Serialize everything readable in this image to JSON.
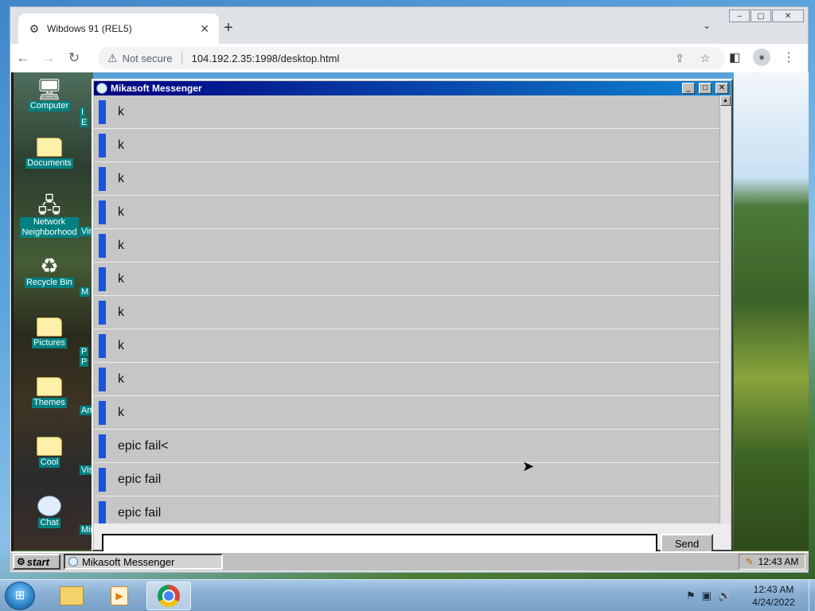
{
  "browser": {
    "tab_title": "Wibdows 91 (REL5)",
    "tab_favicon": "gear-icon",
    "tab_close": "✕",
    "new_tab": "+",
    "tab_search": "⌄",
    "security_label": "Not secure",
    "url": "104.192.2.35:1998/desktop.html",
    "window_controls": {
      "minimize": "–",
      "maximize": "▢",
      "close": "✕"
    }
  },
  "desktop": {
    "icons": [
      {
        "label": "Computer",
        "icon": "computer-icon"
      },
      {
        "label": "Documents",
        "icon": "documents-icon"
      },
      {
        "label": "Network\nNeighborhood",
        "icon": "network-icon"
      },
      {
        "label": "Recycle Bin",
        "icon": "recycle-bin-icon"
      },
      {
        "label": "Pictures",
        "icon": "folder-icon"
      },
      {
        "label": "Themes",
        "icon": "folder-icon"
      },
      {
        "label": "Cool",
        "icon": "folder-icon"
      },
      {
        "label": "Chat",
        "icon": "chat-icon"
      }
    ],
    "peek_labels": [
      "I",
      "E",
      "Virtu",
      "M",
      "P",
      "P",
      "Ame",
      "Vis",
      "Min"
    ]
  },
  "messenger": {
    "title": "Mikasoft Messenger",
    "messages": [
      "k",
      "k",
      "k",
      "k",
      "k",
      "k",
      "k",
      "k",
      "k",
      "k",
      "epic fail<",
      "epic fail",
      "epic fail"
    ],
    "input_value": "",
    "send_label": "Send"
  },
  "w93_taskbar": {
    "start_label": "start",
    "task_label": "Mikasoft Messenger",
    "clock": "12:43 AM"
  },
  "win7_taskbar": {
    "time": "12:43 AM",
    "date": "4/24/2022"
  }
}
